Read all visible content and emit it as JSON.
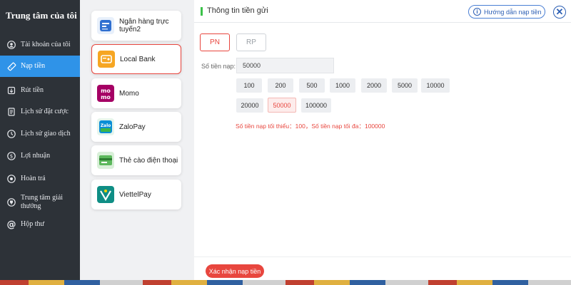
{
  "sidebar": {
    "title": "Trung tâm của tôi",
    "items": [
      {
        "label": "Tài khoản của tôi",
        "icon": "user-circle-icon"
      },
      {
        "label": "Nạp tiền",
        "icon": "ticket-icon",
        "active": true
      },
      {
        "label": "Rút tiền",
        "icon": "withdraw-icon"
      },
      {
        "label": "Lịch sử đặt cược",
        "icon": "bet-history-icon"
      },
      {
        "label": "Lịch sử giao dịch",
        "icon": "transaction-history-icon"
      },
      {
        "label": "Lợi nhuận",
        "icon": "profit-icon"
      },
      {
        "label": "Hoàn trả",
        "icon": "refund-icon"
      },
      {
        "label": "Trung tâm giải thưởng",
        "icon": "trophy-icon"
      },
      {
        "label": "Hộp thư",
        "icon": "at-icon"
      }
    ]
  },
  "methods": [
    {
      "name": "Ngân hàng trực tuyến2",
      "logo": "online-bank-logo"
    },
    {
      "name": "Local Bank",
      "logo": "local-bank-logo",
      "selected": true
    },
    {
      "name": "Momo",
      "logo": "momo-logo"
    },
    {
      "name": "ZaloPay",
      "logo": "zalopay-logo"
    },
    {
      "name": "Thẻ cào điện thoại",
      "logo": "phone-card-logo"
    },
    {
      "name": "ViettelPay",
      "logo": "viettelpay-logo"
    }
  ],
  "header": {
    "title": "Thông tin tiền gửi",
    "guide_label": "Hướng dẫn nạp tiền",
    "close_symbol": "✕"
  },
  "currency": {
    "options": [
      "PN",
      "RP"
    ],
    "selected": "PN"
  },
  "amount": {
    "label": "Số tiền nạp:",
    "value": "50000",
    "quick_row1": [
      "100",
      "200",
      "500",
      "1000",
      "2000",
      "5000",
      "10000"
    ],
    "quick_row2": [
      "20000",
      "50000",
      "100000"
    ],
    "selected": "50000",
    "limit_text": "Số tiền nạp tối thiểu：100，Số tiền nạp tối đa：100000"
  },
  "footer": {
    "confirm_label": "Xác nhận nạp tiền"
  },
  "colors": {
    "accent_red": "#e8463e",
    "sidebar_bg": "#2d3238",
    "active_blue": "#2f93e8",
    "link_blue": "#2c5fb4",
    "header_marker": "#3cc24a"
  }
}
